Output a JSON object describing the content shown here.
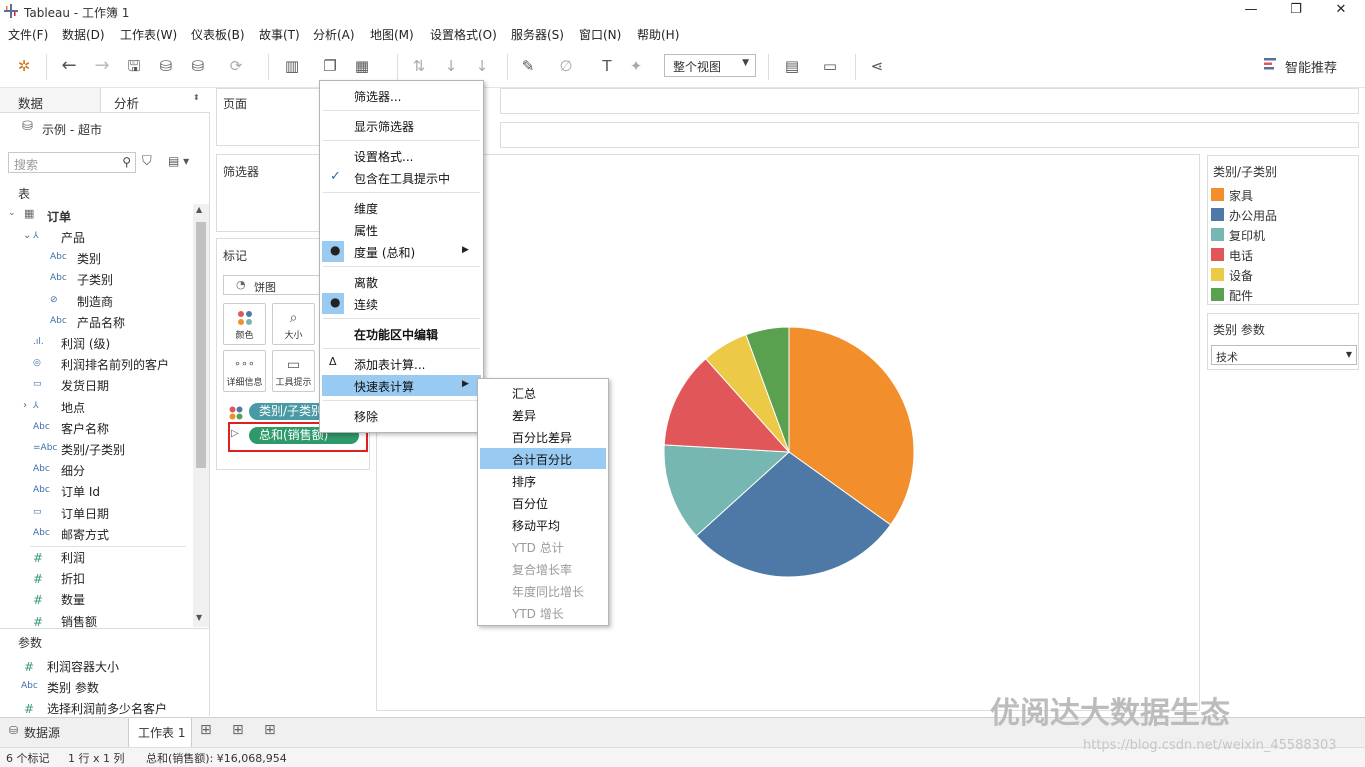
{
  "window": {
    "title": "Tableau - 工作簿 1",
    "controls": [
      "—",
      "❐",
      "✕"
    ]
  },
  "menubar": [
    "文件(F)",
    "数据(D)",
    "工作表(W)",
    "仪表板(B)",
    "故事(T)",
    "分析(A)",
    "地图(M)",
    "设置格式(O)",
    "服务器(S)",
    "窗口(N)",
    "帮助(H)"
  ],
  "toolbar": {
    "view_mode": "整个视图",
    "show_me": "智能推荐"
  },
  "left": {
    "tabs": [
      "数据",
      "分析"
    ],
    "datasource": "示例 - 超市",
    "search_placeholder": "搜索",
    "tables_header": "表",
    "table": "订单",
    "fields": [
      {
        "icon": "⅄",
        "label": "产品",
        "indent": 1,
        "type": "hier"
      },
      {
        "icon": "Abc",
        "label": "类别",
        "indent": 2,
        "type": "dim"
      },
      {
        "icon": "Abc",
        "label": "子类别",
        "indent": 2,
        "type": "dim"
      },
      {
        "icon": "⊘",
        "label": "制造商",
        "indent": 2,
        "type": "dim"
      },
      {
        "icon": "Abc",
        "label": "产品名称",
        "indent": 2,
        "type": "dim"
      },
      {
        "icon": ".ıl.",
        "label": "利润 (级)",
        "indent": 1,
        "type": "dim"
      },
      {
        "icon": "◎",
        "label": "利润排名前列的客户",
        "indent": 1,
        "type": "dim"
      },
      {
        "icon": "▭",
        "label": "发货日期",
        "indent": 1,
        "type": "dim"
      },
      {
        "icon": "⅄",
        "label": "地点",
        "indent": 1,
        "type": "hier"
      },
      {
        "icon": "Abc",
        "label": "客户名称",
        "indent": 1,
        "type": "dim"
      },
      {
        "icon": "=Abc",
        "label": "类别/子类别",
        "indent": 1,
        "type": "dim"
      },
      {
        "icon": "Abc",
        "label": "细分",
        "indent": 1,
        "type": "dim"
      },
      {
        "icon": "Abc",
        "label": "订单 Id",
        "indent": 1,
        "type": "dim"
      },
      {
        "icon": "▭",
        "label": "订单日期",
        "indent": 1,
        "type": "dim"
      },
      {
        "icon": "Abc",
        "label": "邮寄方式",
        "indent": 1,
        "type": "dim"
      },
      {
        "icon": "#",
        "label": "利润",
        "indent": 1,
        "type": "measure"
      },
      {
        "icon": "#",
        "label": "折扣",
        "indent": 1,
        "type": "measure"
      },
      {
        "icon": "#",
        "label": "数量",
        "indent": 1,
        "type": "measure"
      },
      {
        "icon": "#",
        "label": "销售额",
        "indent": 1,
        "type": "measure"
      }
    ],
    "params_header": "参数",
    "params": [
      {
        "icon": "#",
        "label": "利润容器大小"
      },
      {
        "icon": "Abc",
        "label": "类别 参数"
      },
      {
        "icon": "#",
        "label": "选择利润前多少名客户"
      }
    ]
  },
  "shelves": {
    "pages": "页面",
    "filters": "筛选器",
    "marks": "标记",
    "mark_type": "饼图",
    "mark_buttons": [
      "颜色",
      "大小",
      "详细信息",
      "工具提示"
    ],
    "pills": [
      "类别/子类别",
      "总和(销售额)"
    ]
  },
  "legend": {
    "title": "类别/子类别",
    "items": [
      {
        "label": "家具",
        "color": "#f28e2b"
      },
      {
        "label": "办公用品",
        "color": "#4e79a7"
      },
      {
        "label": "复印机",
        "color": "#76b7b2"
      },
      {
        "label": "电话",
        "color": "#e15759"
      },
      {
        "label": "设备",
        "color": "#edc948"
      },
      {
        "label": "配件",
        "color": "#59a14f"
      }
    ]
  },
  "param_card": {
    "title": "类别 参数",
    "value": "技术"
  },
  "chart_data": {
    "type": "pie",
    "categories": [
      "家具",
      "办公用品",
      "复印机",
      "电话",
      "设备",
      "配件"
    ],
    "values": [
      34.9,
      28.4,
      12.6,
      12.5,
      6.0,
      5.6
    ],
    "colors": [
      "#f28e2b",
      "#4e79a7",
      "#76b7b2",
      "#e15759",
      "#edc948",
      "#59a14f"
    ]
  },
  "context_menu": {
    "items": [
      {
        "label": "筛选器...",
        "mark": ""
      },
      {
        "sep": true
      },
      {
        "label": "显示筛选器",
        "mark": ""
      },
      {
        "sep": true
      },
      {
        "label": "设置格式...",
        "mark": ""
      },
      {
        "label": "包含在工具提示中",
        "mark": "check"
      },
      {
        "sep": true
      },
      {
        "label": "维度",
        "mark": ""
      },
      {
        "label": "属性",
        "mark": ""
      },
      {
        "label": "度量 (总和)",
        "mark": "dot",
        "submenu": true
      },
      {
        "sep": true
      },
      {
        "label": "离散",
        "mark": ""
      },
      {
        "label": "连续",
        "mark": "dot"
      },
      {
        "sep": true
      },
      {
        "label": "在功能区中编辑",
        "mark": "",
        "bold": true
      },
      {
        "sep": true
      },
      {
        "label": "添加表计算...",
        "mark": "delta"
      },
      {
        "label": "快速表计算",
        "mark": "",
        "submenu": true,
        "highlight": true
      },
      {
        "sep": true
      },
      {
        "label": "移除",
        "mark": ""
      }
    ]
  },
  "submenu": {
    "items": [
      {
        "label": "汇总",
        "enabled": true
      },
      {
        "label": "差异",
        "enabled": true
      },
      {
        "label": "百分比差异",
        "enabled": true
      },
      {
        "label": "合计百分比",
        "enabled": true,
        "highlight": true
      },
      {
        "label": "排序",
        "enabled": true
      },
      {
        "label": "百分位",
        "enabled": true
      },
      {
        "label": "移动平均",
        "enabled": true
      },
      {
        "label": "YTD 总计",
        "enabled": false
      },
      {
        "label": "复合增长率",
        "enabled": false
      },
      {
        "label": "年度同比增长",
        "enabled": false
      },
      {
        "label": "YTD 增长",
        "enabled": false
      }
    ]
  },
  "sheetbar": {
    "datasource_tab": "数据源",
    "sheet_tab": "工作表 1"
  },
  "status": {
    "marks": "6 个标记",
    "rows_cols": "1 行 x 1 列",
    "sum": "总和(销售额): ¥16,068,954"
  },
  "watermark": {
    "text": "优阅达大数据生态",
    "url": "https://blog.csdn.net/weixin_45588303"
  }
}
